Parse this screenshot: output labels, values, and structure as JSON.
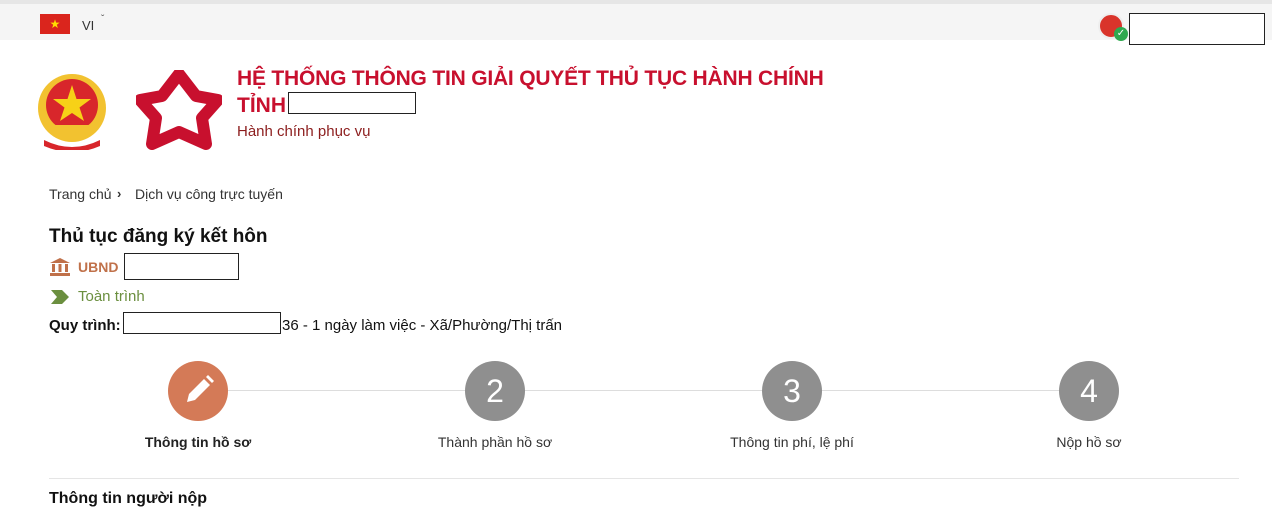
{
  "topbar": {
    "language": "VI",
    "caret": "ˇ",
    "flag_star": "★",
    "avatar_check": "✓"
  },
  "header": {
    "title_line1": "HỆ THỐNG THÔNG TIN GIẢI QUYẾT THỦ TỤC HÀNH CHÍNH",
    "title_line2": "TỈNH",
    "subtitle": "Hành chính phục vụ"
  },
  "breadcrumb": {
    "items": [
      "Trang chủ",
      "Dịch vụ công trực tuyến"
    ],
    "separator": "›"
  },
  "procedure": {
    "title": "Thủ tục đăng ký kết hôn",
    "agency_label": "UBND",
    "level": "Toàn trình",
    "flow_label": "Quy trình:",
    "flow_text": "36 - 1 ngày làm việc - Xã/Phường/Thị trấn"
  },
  "steps": [
    {
      "number": "✎",
      "label": "Thông tin hồ sơ",
      "active": true
    },
    {
      "number": "2",
      "label": "Thành phần hồ sơ",
      "active": false
    },
    {
      "number": "3",
      "label": "Thông tin phí, lệ phí",
      "active": false
    },
    {
      "number": "4",
      "label": "Nộp hồ sơ",
      "active": false
    }
  ],
  "next_section": {
    "peek": "Thông tin người nộp"
  },
  "colors": {
    "title_red": "#c8102e",
    "active_step": "#d47a57",
    "inactive_step": "#8f8f8f",
    "agency": "#c0714a",
    "level_green": "#6b8f3f"
  },
  "icons": {
    "flag": "vietnam-flag-icon",
    "agency": "bank-building-icon",
    "level": "arrow-tag-icon",
    "edit": "pencil-icon",
    "avatar": "user-avatar-icon"
  }
}
